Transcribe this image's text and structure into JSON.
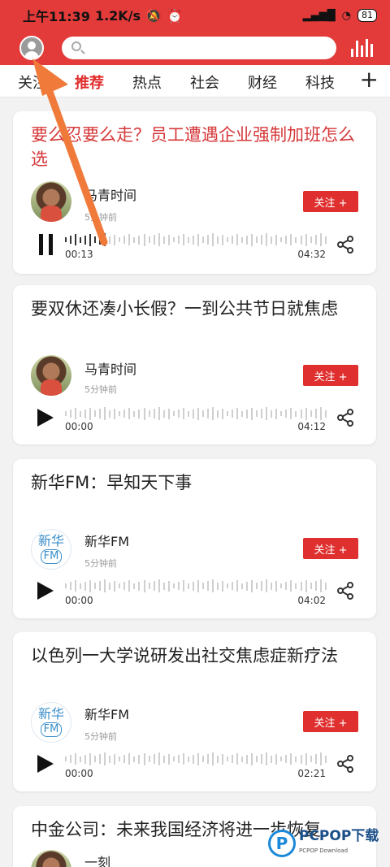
{
  "status_bar": {
    "time": "上午11:39",
    "speed": "1.2K/s",
    "battery": "81"
  },
  "tabs": [
    {
      "label": "关注",
      "active": false
    },
    {
      "label": "推荐",
      "active": true
    },
    {
      "label": "热点",
      "active": false
    },
    {
      "label": "社会",
      "active": false
    },
    {
      "label": "财经",
      "active": false
    },
    {
      "label": "科技",
      "active": false
    }
  ],
  "add_tab_label": "+",
  "follow_label": "关注 +",
  "cards": [
    {
      "title": "要么忍要么走？员工遭遇企业强制加班怎么选",
      "played": true,
      "author": "马青时间",
      "time_ago": "5分钟前",
      "avatar": "photo",
      "state": "playing",
      "progress": 0.15,
      "current": "00:13",
      "duration": "04:32"
    },
    {
      "title": "要双休还凑小长假？一到公共节日就焦虑",
      "played": false,
      "author": "马青时间",
      "time_ago": "5分钟前",
      "avatar": "photo",
      "state": "paused",
      "progress": 0,
      "current": "00:00",
      "duration": "04:12"
    },
    {
      "title": "新华FM：早知天下事",
      "played": false,
      "author": "新华FM",
      "time_ago": "5分钟前",
      "avatar": "logo",
      "logo_text": "新华",
      "logo_sub": "FM",
      "state": "paused",
      "progress": 0,
      "current": "00:00",
      "duration": "04:02"
    },
    {
      "title": "以色列一大学说研发出社交焦虑症新疗法",
      "played": false,
      "author": "新华FM",
      "time_ago": "5分钟前",
      "avatar": "logo",
      "logo_text": "新华",
      "logo_sub": "FM",
      "state": "paused",
      "progress": 0,
      "current": "00:00",
      "duration": "02:21"
    },
    {
      "title": "中金公司：未来我国经济将进一步恢复",
      "played": false,
      "author": "一刻",
      "avatar": "photo",
      "partial": true
    }
  ],
  "watermark": {
    "mark": "P",
    "text": "PCPOP下载",
    "sub": "PCPOP Download"
  },
  "colors": {
    "brand_red": "#e33a3a",
    "active_tab": "#e02c2c",
    "played_title": "#d6383a",
    "arrow": "#f07a3a"
  }
}
